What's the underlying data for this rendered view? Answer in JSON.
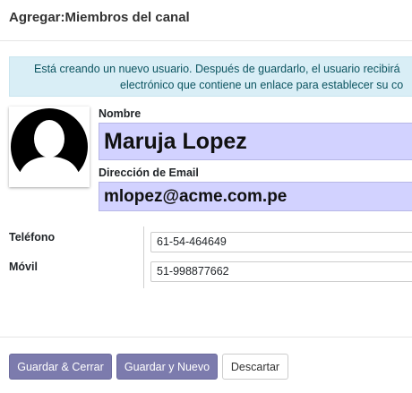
{
  "dialog": {
    "title": "Agregar:Miembros del canal"
  },
  "alert": {
    "line1": "Está creando un nuevo usuario. Después de guardarlo, el usuario recibirá",
    "line2": "electrónico que contiene un enlace para establecer su co"
  },
  "form": {
    "name_label": "Nombre",
    "name_value": "Maruja Lopez",
    "email_label": "Dirección de Email",
    "email_value": "mlopez@acme.com.pe",
    "phone_label": "Teléfono",
    "phone_value": "61-54-464649",
    "mobile_label": "Móvil",
    "mobile_value": "51-998877662"
  },
  "footer": {
    "save_close": "Guardar & Cerrar",
    "save_new": "Guardar y Nuevo",
    "discard": "Descartar"
  },
  "colors": {
    "primary": "#7c7bad",
    "field_highlight": "#d2d2ff",
    "alert_bg": "#d9eef6"
  },
  "icons": {
    "avatar": "user-placeholder-icon"
  }
}
